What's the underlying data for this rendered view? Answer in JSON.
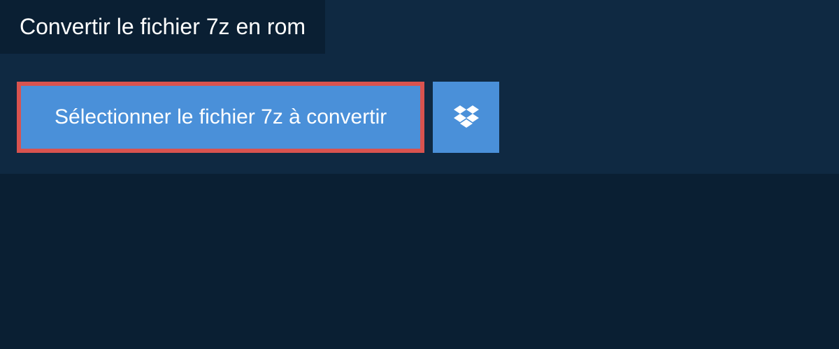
{
  "title": "Convertir le fichier 7z en rom",
  "buttons": {
    "select_file": "Sélectionner le fichier 7z à convertir"
  }
}
